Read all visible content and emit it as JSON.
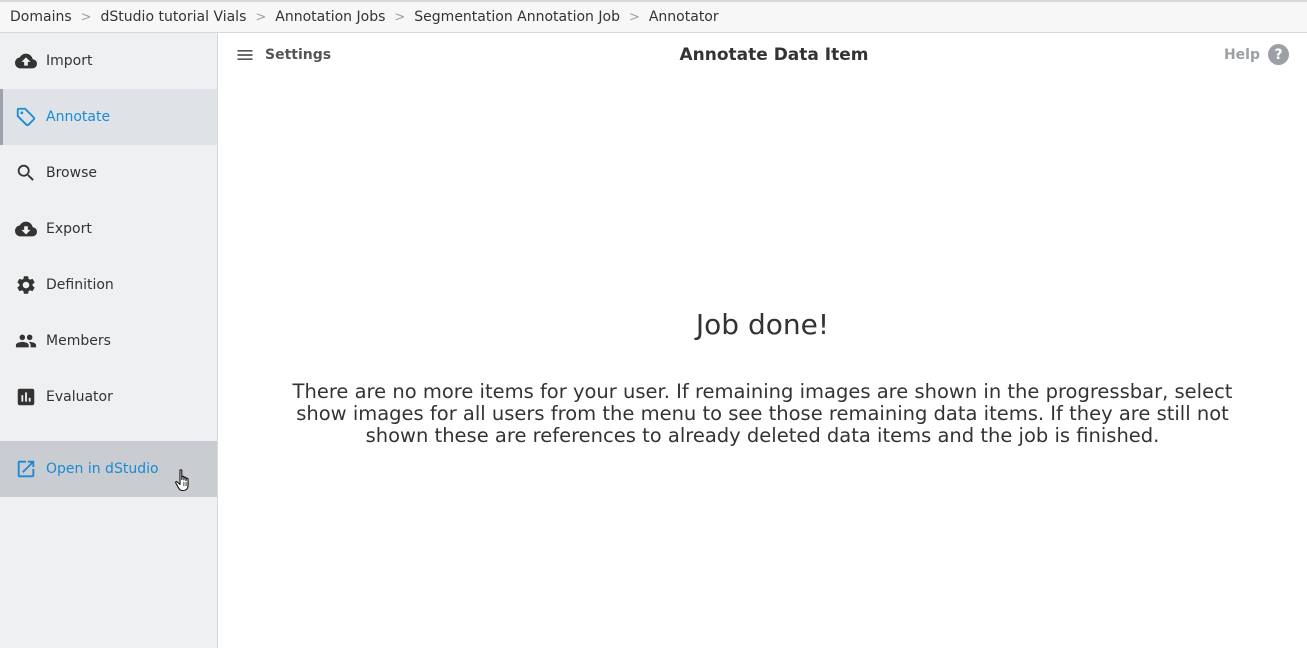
{
  "breadcrumb": [
    {
      "label": "Domains"
    },
    {
      "label": "dStudio tutorial Vials"
    },
    {
      "label": "Annotation Jobs"
    },
    {
      "label": "Segmentation Annotation Job"
    },
    {
      "label": "Annotator"
    }
  ],
  "breadcrumb_separator": ">",
  "sidebar": {
    "items": [
      {
        "label": "Import",
        "icon": "cloud-upload-icon"
      },
      {
        "label": "Annotate",
        "icon": "tag-icon",
        "state": "active"
      },
      {
        "label": "Browse",
        "icon": "search-icon"
      },
      {
        "label": "Export",
        "icon": "cloud-download-icon"
      },
      {
        "label": "Definition",
        "icon": "gear-icon"
      },
      {
        "label": "Members",
        "icon": "people-icon"
      },
      {
        "label": "Evaluator",
        "icon": "bar-chart-icon"
      },
      {
        "label": "Open in dStudio",
        "icon": "external-link-icon",
        "state": "hover"
      }
    ]
  },
  "header": {
    "settings_label": "Settings",
    "title": "Annotate Data Item",
    "help_label": "Help",
    "help_icon_glyph": "?"
  },
  "content": {
    "title": "Job done!",
    "message": "There are no more items for your user. If remaining images are shown in the progressbar, select show images for all users from the menu to see those remaining data items. If they are still not shown these are references to already deleted data items and the job is finished."
  },
  "colors": {
    "accent": "#1a8ad4",
    "sidebar_bg": "#eef0f2",
    "muted": "#9aa0a6"
  }
}
